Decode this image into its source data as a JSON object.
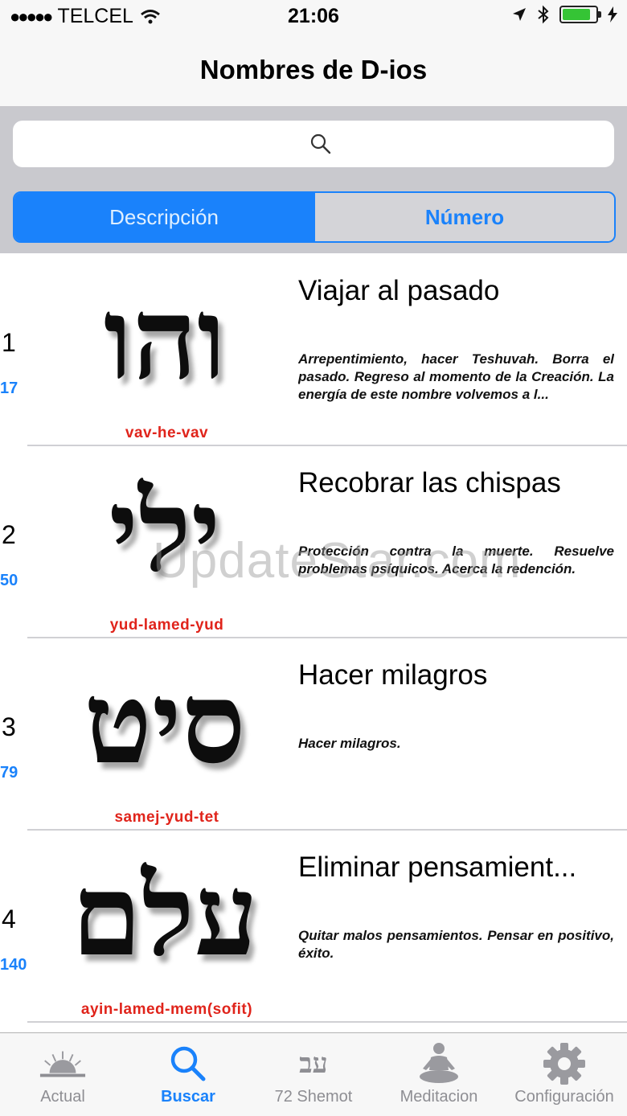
{
  "status_bar": {
    "carrier": "TELCEL",
    "signal_dots": "●●●●●",
    "time": "21:06",
    "battery_level": 0.85,
    "battery_color": "#35c435"
  },
  "nav": {
    "title": "Nombres de D-ios"
  },
  "search": {
    "placeholder": ""
  },
  "segmented": {
    "options": [
      "Descripción",
      "Número"
    ],
    "selected": "Descripción"
  },
  "rows": [
    {
      "index": "1",
      "number": "17",
      "hebrew": "והו",
      "translit": "vav-he-vav",
      "title": "Viajar al pasado",
      "description": "Arrepentimiento, hacer Teshuvah. Borra el pasado. Regreso al momento de la Creación. La energía de este nombre volvemos a l..."
    },
    {
      "index": "2",
      "number": "50",
      "hebrew": "ילי",
      "translit": "yud-lamed-yud",
      "title": "Recobrar las chispas",
      "description": "Protección contra la muerte. Resuelve problemas psíquicos. Acerca la redención."
    },
    {
      "index": "3",
      "number": "79",
      "hebrew": "סיט",
      "translit": "samej-yud-tet",
      "title": "Hacer milagros",
      "description": "Hacer milagros."
    },
    {
      "index": "4",
      "number": "140",
      "hebrew": "עלם",
      "translit": "ayin-lamed-mem(sofit)",
      "title": "Eliminar pensamient...",
      "description": "Quitar malos pensamientos. Pensar en positivo, éxito."
    }
  ],
  "watermark": "UpdateStar.com",
  "tabs": [
    {
      "label": "Actual",
      "icon": "sunrise-icon"
    },
    {
      "label": "Buscar",
      "icon": "search-icon"
    },
    {
      "label": "72 Shemot",
      "icon": "hebrew-letters-icon",
      "glyph": "עב"
    },
    {
      "label": "Meditacion",
      "icon": "meditation-icon"
    },
    {
      "label": "Configuración",
      "icon": "gear-icon"
    }
  ],
  "active_tab": "Buscar",
  "colors": {
    "accent": "#1a82fb",
    "translit": "#e0241b"
  }
}
